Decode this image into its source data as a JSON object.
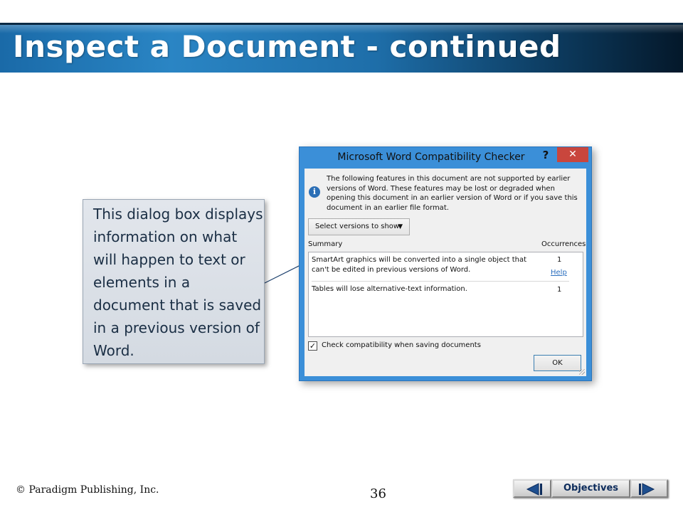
{
  "slide": {
    "title": "Inspect a Document - continued",
    "callout_text": "This dialog box displays information on what will happen to text or elements in a document that is saved in a previous version of Word.",
    "footer_copyright": "© Paradigm Publishing, Inc.",
    "page_number": "36"
  },
  "dialog": {
    "title": "Microsoft Word Compatibility Checker",
    "help_label": "?",
    "close_label": "✕",
    "info_icon": "info-icon",
    "info_text": "The following features in this document are not supported by earlier versions of Word. These features may be lost or degraded when opening this document in an earlier version of Word or if you save this document in an earlier file format.",
    "select_versions_label": "Select versions to show",
    "summary_header": "Summary",
    "occurrences_header": "Occurrences",
    "issues": [
      {
        "text": "SmartArt graphics will be converted into a single object that can't be edited in previous versions of Word.",
        "count": "1",
        "help_link": "Help"
      },
      {
        "text": "Tables will lose alternative-text information.",
        "count": "1"
      }
    ],
    "check_label": "Check compatibility when saving documents",
    "check_checked": true,
    "ok_label": "OK"
  },
  "nav": {
    "objectives_label": "Objectives",
    "prev_icon": "triangle-left-icon",
    "next_icon": "triangle-right-icon"
  },
  "colors": {
    "title_blue": "#1e6ea9",
    "dialog_frame": "#3b8fd8",
    "close_red": "#c9463d",
    "callout_text": "#1a2e44",
    "link_blue": "#2a6ebf"
  }
}
